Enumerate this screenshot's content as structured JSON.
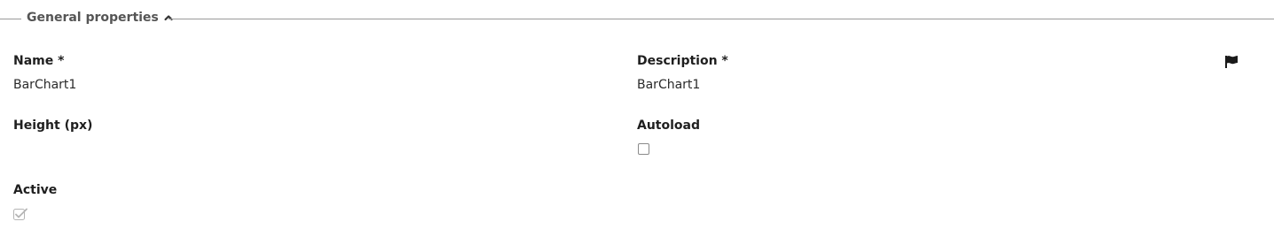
{
  "section": {
    "title": "General properties"
  },
  "fields": {
    "name": {
      "label": "Name *",
      "value": "BarChart1"
    },
    "description": {
      "label": "Description *",
      "value": "BarChart1"
    },
    "height": {
      "label": "Height (px)",
      "value": ""
    },
    "autoload": {
      "label": "Autoload",
      "checked": false
    },
    "active": {
      "label": "Active",
      "checked": true,
      "disabled": true
    }
  },
  "icons": {
    "collapse": "chevron-up-icon",
    "flag": "flag-icon"
  }
}
